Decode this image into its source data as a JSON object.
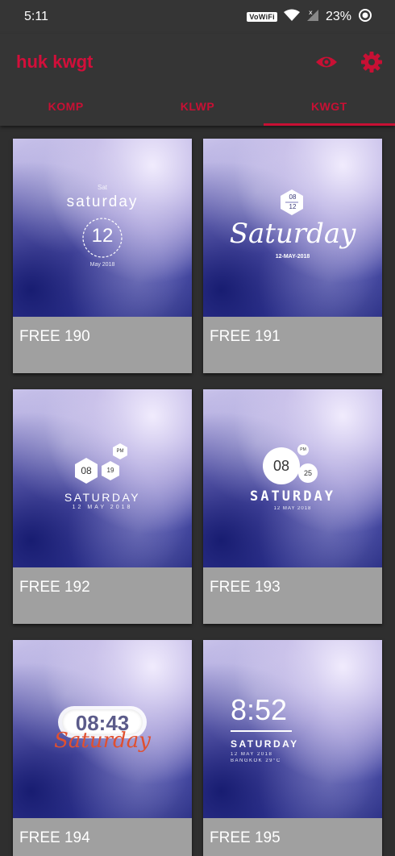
{
  "status_bar": {
    "time": "5:11",
    "vowifi": "VoWiFi",
    "battery": "23%"
  },
  "app_bar": {
    "title": "huk kwgt"
  },
  "tabs": [
    {
      "label": "KOMP",
      "active": false
    },
    {
      "label": "KLWP",
      "active": false
    },
    {
      "label": "KWGT",
      "active": true
    }
  ],
  "colors": {
    "accent": "#d20f3a",
    "background": "#2f2f2f",
    "card_label_bg": "#a0a0a0"
  },
  "cards": [
    {
      "label": "FREE 190",
      "widget": {
        "small": "Sat",
        "day": "saturday",
        "num": "12",
        "date": "May 2018"
      }
    },
    {
      "label": "FREE 191",
      "widget": {
        "num_top": "08",
        "num_bottom": "12",
        "day": "Saturday",
        "date": "12-MAY-2018"
      }
    },
    {
      "label": "FREE 192",
      "widget": {
        "ampm": "PM",
        "hour": "08",
        "min": "19",
        "day": "SATURDAY",
        "date": "12  MAY  2018"
      }
    },
    {
      "label": "FREE 193",
      "widget": {
        "ampm": "PM",
        "hour": "08",
        "min": "25",
        "day": "SATURDAY",
        "date": "12 MAY 2018"
      }
    },
    {
      "label": "FREE 194",
      "widget": {
        "time": "08:43",
        "day": "Saturday"
      }
    },
    {
      "label": "FREE 195",
      "widget": {
        "time": "8:52",
        "day": "SATURDAY",
        "date": "12 MAY 2018",
        "location": "BANGKOK 29°C"
      }
    }
  ]
}
